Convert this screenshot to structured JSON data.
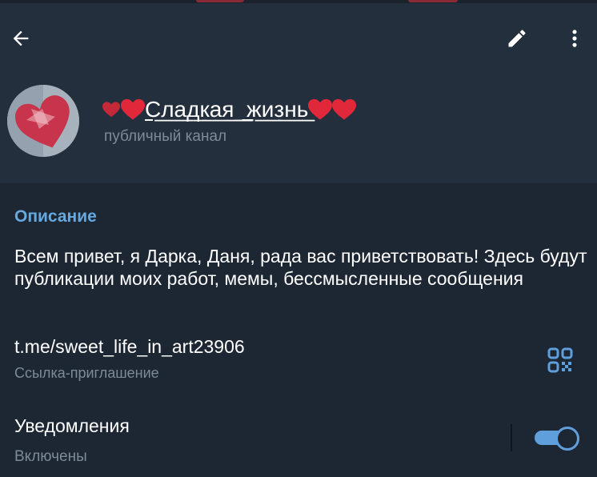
{
  "header": {
    "channel_name": "С̲л̲а̲д̲к̲а̲я̲_̲ж̲и̲з̲н̲ь̲",
    "channel_type": "публичный канал"
  },
  "icons": {
    "back": "arrow-left-icon",
    "edit": "pencil-icon",
    "more": "more-vertical-icon",
    "qr": "qr-code-icon",
    "heart": "heart-icon"
  },
  "info": {
    "section_title": "Описание",
    "description": "Всем привет,  я Дарка, Даня, рада вас приветствовать! Здесь будут публикации моих работ, мемы, бессмысленные сообщения",
    "link": "t.me/sweet_life_in_art23906",
    "link_caption": "Ссылка-приглашение"
  },
  "notifications": {
    "label": "Уведомления",
    "status": "Включены",
    "enabled": true
  },
  "colors": {
    "header_bg": "#242f3d",
    "content_bg": "#1d2733",
    "accent": "#66a9e0",
    "secondary_text": "#7d8b99",
    "heart": "#e0283a"
  }
}
